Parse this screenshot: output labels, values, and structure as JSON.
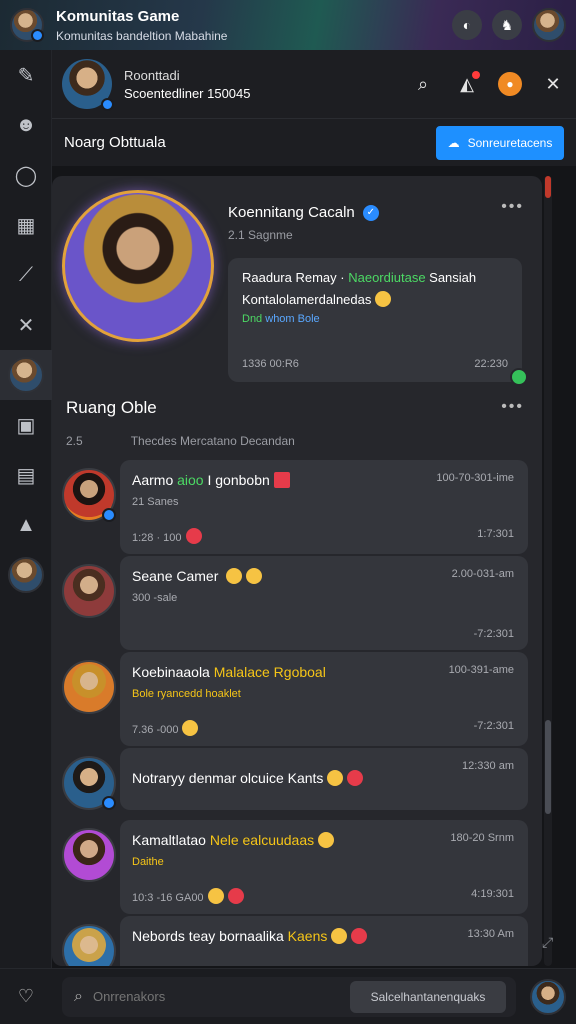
{
  "banner": {
    "title": "Komunitas Game",
    "subtitle": "Komunitas bandeltion Mabahine"
  },
  "header": {
    "title": "Roonttadi",
    "subtitle": "Scoentedliner 150045"
  },
  "subheader": {
    "title": "Noarg Obttuala",
    "button_label": "Sonreuretacens"
  },
  "profile": {
    "name": "Koennitang Cacaln",
    "meta": "2.1 Sagnme",
    "message_line1_prefix": "Raadura Remay · ",
    "message_line1_highlight": "Naeordiutase",
    "message_line1_suffix": " Sansiah",
    "message_line2": "Kontalolamerdalnedas",
    "message_line3_prefix": "Dnd ",
    "message_line3_blue": "whom Bole",
    "message_time_left": "1336 00:R6",
    "message_time_right": "22:230"
  },
  "section": {
    "title": "Ruang Oble",
    "count": "2.5",
    "meta": "Thecdes Mercatano Decandan"
  },
  "items": [
    {
      "title_prefix": "Aarmo ",
      "title_highlight": "aioo",
      "title_suffix": " I gonbobn",
      "sub": "21 Sanes",
      "time": "100-70-301-ime",
      "foot_left": "1:28 · 100",
      "foot_right": "1:7:301"
    },
    {
      "title_prefix": "Seane Camer ",
      "title_highlight": "",
      "title_suffix": "",
      "sub": "300 -sale",
      "time": "2.00-031-am",
      "foot_left": "",
      "foot_right": "-7:2:301"
    },
    {
      "title_prefix": "Koebinaaola ",
      "title_highlight": "Malalace Rgoboal",
      "title_suffix": "",
      "sub": "Bole ryancedd hoaklet",
      "time": "100-391-ame",
      "foot_left": "7.36 -000",
      "foot_right": "-7:2:301"
    },
    {
      "title_prefix": "Notraryy denmar olcuice Kants",
      "title_highlight": "",
      "title_suffix": "",
      "sub": "",
      "time": "12:330 am",
      "foot_left": "",
      "foot_right": ""
    },
    {
      "title_prefix": "Kamaltlatao ",
      "title_highlight": "Nele ealcuudaas",
      "title_suffix": "",
      "sub": "Daithe",
      "time": "180-20 Srnm",
      "foot_left": "10:3 -16 GA00",
      "foot_right": "4:19:301"
    },
    {
      "title_prefix": "Nebords teay bornaalika ",
      "title_highlight": "Kaens",
      "title_suffix": "",
      "sub": "",
      "time": "13:30 Am",
      "foot_left": "",
      "foot_right": ""
    }
  ],
  "bottom": {
    "search_placeholder": "Onrrenakors",
    "send_label": "Salcelhantanenquaks"
  },
  "colors": {
    "accent": "#1e90ff",
    "green": "#4cd964",
    "yellow": "#f5c518",
    "panel": "#26272c",
    "card": "#34363c"
  }
}
